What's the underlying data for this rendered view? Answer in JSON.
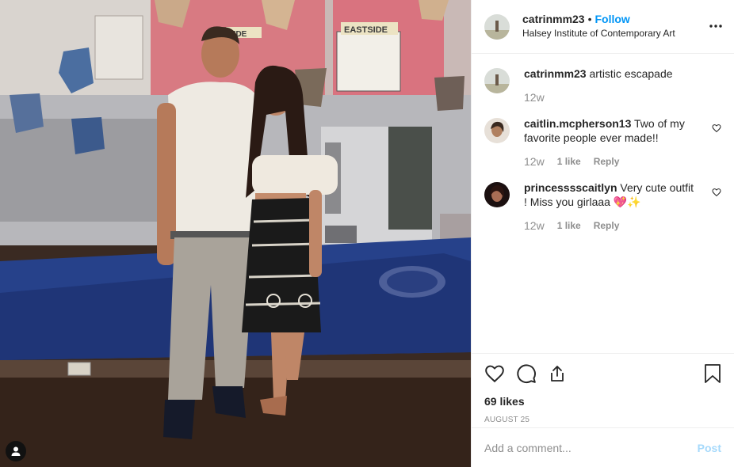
{
  "post": {
    "author": {
      "username": "catrinmm23",
      "follow_label": "Follow",
      "separator": "•",
      "location": "Halsey Institute of Contemporary Art"
    },
    "photo": {
      "sign_text": "EASTSIDE",
      "sign_text_2": "SIDE"
    },
    "caption": {
      "username": "catrinmm23",
      "text": "artistic escapade",
      "time": "12w"
    },
    "comments": [
      {
        "username": "caitlin.mcpherson13",
        "text": "Two of my favorite people ever made!!",
        "time": "12w",
        "likes": "1 like",
        "reply_label": "Reply"
      },
      {
        "username": "princesssscaitlyn",
        "text": "Very cute outfit ! Miss you girlaaa 💖✨",
        "time": "12w",
        "likes": "1 like",
        "reply_label": "Reply"
      }
    ],
    "actions": {
      "like_icon": "heart-outline-icon",
      "comment_icon": "speech-bubble-icon",
      "share_icon": "share-icon",
      "save_icon": "bookmark-icon"
    },
    "likes_count": "69 likes",
    "date": "AUGUST 25",
    "add_comment": {
      "placeholder": "Add a comment...",
      "post_label": "Post"
    },
    "colors": {
      "accent": "#0095f6",
      "muted": "#8e8e8e",
      "text": "#262626"
    }
  }
}
